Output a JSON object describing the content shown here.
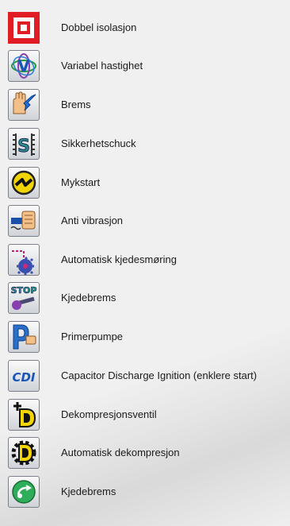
{
  "features": [
    {
      "label": "Dobbel isolasjon",
      "icon": "double-insulation-icon"
    },
    {
      "label": "Variabel hastighet",
      "icon": "variable-speed-icon"
    },
    {
      "label": "Brems",
      "icon": "brake-hand-icon"
    },
    {
      "label": "Sikkerhetschuck",
      "icon": "safety-chuck-icon"
    },
    {
      "label": "Mykstart",
      "icon": "soft-start-icon"
    },
    {
      "label": "Anti vibrasjon",
      "icon": "anti-vibration-icon"
    },
    {
      "label": "Automatisk kjedesmøring",
      "icon": "chain-oiling-icon"
    },
    {
      "label": "Kjedebrems",
      "icon": "chain-brake-stop-icon"
    },
    {
      "label": "Primerpumpe",
      "icon": "primer-pump-icon"
    },
    {
      "label": "Capacitor Discharge Ignition (enklere start)",
      "icon": "cdi-icon"
    },
    {
      "label": "Dekompresjonsventil",
      "icon": "decompression-valve-icon"
    },
    {
      "label": "Automatisk dekompresjon",
      "icon": "auto-decompression-icon"
    },
    {
      "label": "Kjedebrems",
      "icon": "chain-brake-icon"
    }
  ]
}
